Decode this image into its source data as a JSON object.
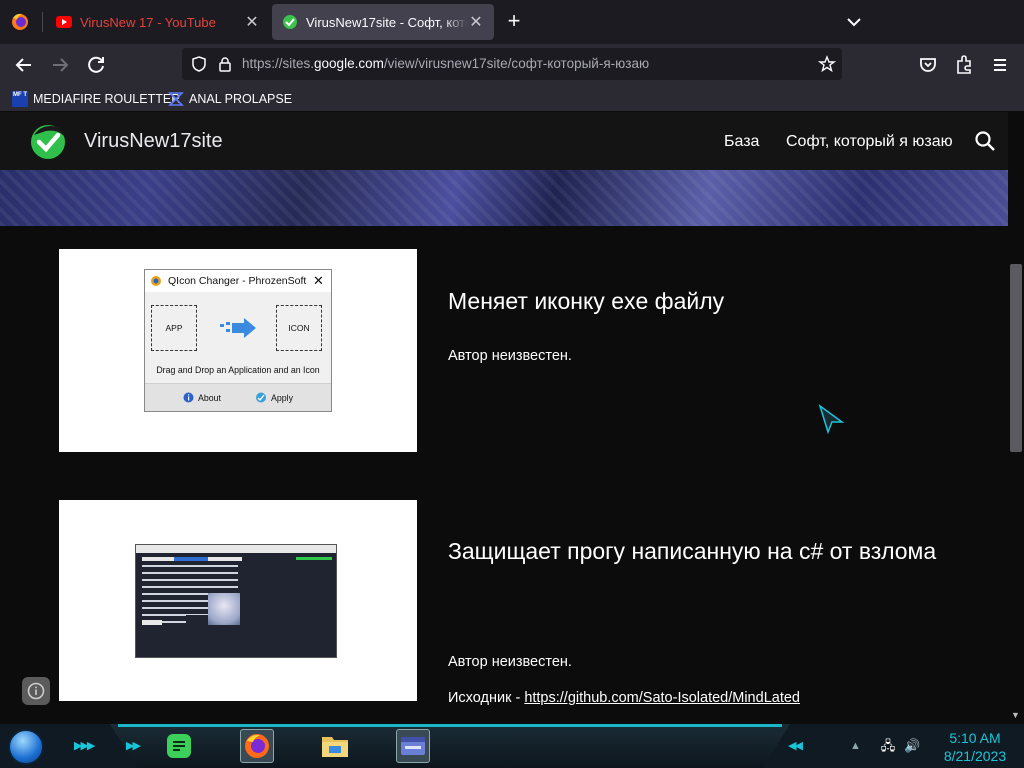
{
  "browser": {
    "tabs": [
      {
        "title": "VirusNew 17 - YouTube",
        "favicon": "youtube-icon"
      },
      {
        "title": "VirusNew17site - Софт, который я юзаю",
        "favicon": "checkmark-favicon",
        "active": true
      }
    ],
    "url_prefix": "https://sites.",
    "url_domain": "google.com",
    "url_path": "/view/virusnew17site/софт-который-я-юзаю",
    "bookmarks": [
      {
        "label": "MEDIAFIRE ROULETTER"
      },
      {
        "label": "ANAL PROLAPSE"
      }
    ],
    "mediafire_icon_text": "MF T"
  },
  "site": {
    "name": "VirusNew17site",
    "nav": [
      {
        "label": "База"
      },
      {
        "label": "Софт, который я юзаю"
      }
    ]
  },
  "cards": [
    {
      "heading": "Меняет иконку exe файлу",
      "author": "Автор неизвестен.",
      "screenshot": {
        "window_title": "QIcon Changer - PhrozenSoft",
        "app_label": "APP",
        "icon_label": "ICON",
        "caption": "Drag and Drop an Application and an Icon",
        "about": "About",
        "apply": "Apply"
      }
    },
    {
      "heading": "Защищает прогу написанную на c# от взлома",
      "author": "Автор неизвестен.",
      "source_prefix": "Исходник - ",
      "source_link": "https://github.com/Sato-Isolated/MindLated"
    }
  ],
  "taskbar": {
    "time": "5:10 AM",
    "date": "8/21/2023"
  },
  "colors": {
    "accent": "#19c6d9",
    "page_bg": "#0c0c0d",
    "header_bg": "#141415",
    "youtube_red": "#e9413a"
  }
}
